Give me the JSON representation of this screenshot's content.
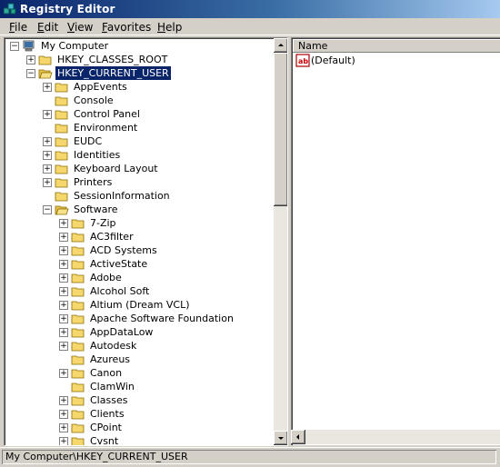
{
  "window": {
    "title": "Registry Editor"
  },
  "menu": [
    "File",
    "Edit",
    "View",
    "Favorites",
    "Help"
  ],
  "tree": [
    {
      "label": "My Computer",
      "icon": "computer-icon",
      "level": 0,
      "expander": "minus"
    },
    {
      "label": "HKEY_CLASSES_ROOT",
      "icon": "folder-icon",
      "level": 1,
      "expander": "plus"
    },
    {
      "label": "HKEY_CURRENT_USER",
      "icon": "folder-open-icon",
      "level": 1,
      "expander": "minus",
      "selected": true
    },
    {
      "label": "AppEvents",
      "icon": "folder-icon",
      "level": 2,
      "expander": "plus"
    },
    {
      "label": "Console",
      "icon": "folder-icon",
      "level": 2,
      "expander": "none"
    },
    {
      "label": "Control Panel",
      "icon": "folder-icon",
      "level": 2,
      "expander": "plus"
    },
    {
      "label": "Environment",
      "icon": "folder-icon",
      "level": 2,
      "expander": "none"
    },
    {
      "label": "EUDC",
      "icon": "folder-icon",
      "level": 2,
      "expander": "plus"
    },
    {
      "label": "Identities",
      "icon": "folder-icon",
      "level": 2,
      "expander": "plus"
    },
    {
      "label": "Keyboard Layout",
      "icon": "folder-icon",
      "level": 2,
      "expander": "plus"
    },
    {
      "label": "Printers",
      "icon": "folder-icon",
      "level": 2,
      "expander": "plus"
    },
    {
      "label": "SessionInformation",
      "icon": "folder-icon",
      "level": 2,
      "expander": "none"
    },
    {
      "label": "Software",
      "icon": "folder-open-icon",
      "level": 2,
      "expander": "minus"
    },
    {
      "label": "7-Zip",
      "icon": "folder-icon",
      "level": 3,
      "expander": "plus"
    },
    {
      "label": "AC3filter",
      "icon": "folder-icon",
      "level": 3,
      "expander": "plus"
    },
    {
      "label": "ACD Systems",
      "icon": "folder-icon",
      "level": 3,
      "expander": "plus"
    },
    {
      "label": "ActiveState",
      "icon": "folder-icon",
      "level": 3,
      "expander": "plus"
    },
    {
      "label": "Adobe",
      "icon": "folder-icon",
      "level": 3,
      "expander": "plus"
    },
    {
      "label": "Alcohol Soft",
      "icon": "folder-icon",
      "level": 3,
      "expander": "plus"
    },
    {
      "label": "Altium (Dream VCL)",
      "icon": "folder-icon",
      "level": 3,
      "expander": "plus"
    },
    {
      "label": "Apache Software Foundation",
      "icon": "folder-icon",
      "level": 3,
      "expander": "plus"
    },
    {
      "label": "AppDataLow",
      "icon": "folder-icon",
      "level": 3,
      "expander": "plus"
    },
    {
      "label": "Autodesk",
      "icon": "folder-icon",
      "level": 3,
      "expander": "plus"
    },
    {
      "label": "Azureus",
      "icon": "folder-icon",
      "level": 3,
      "expander": "none"
    },
    {
      "label": "Canon",
      "icon": "folder-icon",
      "level": 3,
      "expander": "plus"
    },
    {
      "label": "ClamWin",
      "icon": "folder-icon",
      "level": 3,
      "expander": "none"
    },
    {
      "label": "Classes",
      "icon": "folder-icon",
      "level": 3,
      "expander": "plus"
    },
    {
      "label": "Clients",
      "icon": "folder-icon",
      "level": 3,
      "expander": "plus"
    },
    {
      "label": "CPoint",
      "icon": "folder-icon",
      "level": 3,
      "expander": "plus"
    },
    {
      "label": "Cvsnt",
      "icon": "folder-icon",
      "level": 3,
      "expander": "plus"
    }
  ],
  "list": {
    "column_name": "Name",
    "values": [
      {
        "icon": "string-value-icon",
        "name": "(Default)"
      }
    ]
  },
  "statusbar": {
    "path": "My Computer\\HKEY_CURRENT_USER"
  },
  "colors": {
    "title_start": "#0a246a",
    "title_end": "#a6caf0",
    "selection": "#0a246a",
    "folder": "#f5d76e"
  }
}
